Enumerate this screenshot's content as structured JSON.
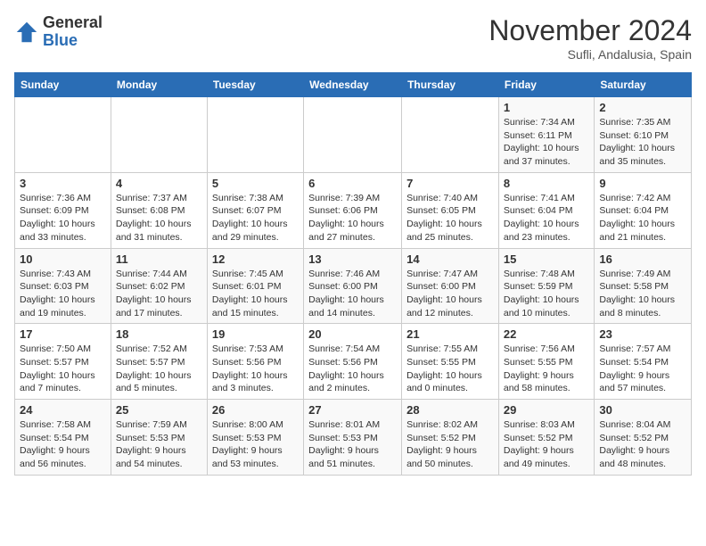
{
  "logo": {
    "line1": "General",
    "line2": "Blue"
  },
  "title": "November 2024",
  "location": "Sufli, Andalusia, Spain",
  "weekdays": [
    "Sunday",
    "Monday",
    "Tuesday",
    "Wednesday",
    "Thursday",
    "Friday",
    "Saturday"
  ],
  "weeks": [
    [
      {
        "day": "",
        "info": ""
      },
      {
        "day": "",
        "info": ""
      },
      {
        "day": "",
        "info": ""
      },
      {
        "day": "",
        "info": ""
      },
      {
        "day": "",
        "info": ""
      },
      {
        "day": "1",
        "info": "Sunrise: 7:34 AM\nSunset: 6:11 PM\nDaylight: 10 hours and 37 minutes."
      },
      {
        "day": "2",
        "info": "Sunrise: 7:35 AM\nSunset: 6:10 PM\nDaylight: 10 hours and 35 minutes."
      }
    ],
    [
      {
        "day": "3",
        "info": "Sunrise: 7:36 AM\nSunset: 6:09 PM\nDaylight: 10 hours and 33 minutes."
      },
      {
        "day": "4",
        "info": "Sunrise: 7:37 AM\nSunset: 6:08 PM\nDaylight: 10 hours and 31 minutes."
      },
      {
        "day": "5",
        "info": "Sunrise: 7:38 AM\nSunset: 6:07 PM\nDaylight: 10 hours and 29 minutes."
      },
      {
        "day": "6",
        "info": "Sunrise: 7:39 AM\nSunset: 6:06 PM\nDaylight: 10 hours and 27 minutes."
      },
      {
        "day": "7",
        "info": "Sunrise: 7:40 AM\nSunset: 6:05 PM\nDaylight: 10 hours and 25 minutes."
      },
      {
        "day": "8",
        "info": "Sunrise: 7:41 AM\nSunset: 6:04 PM\nDaylight: 10 hours and 23 minutes."
      },
      {
        "day": "9",
        "info": "Sunrise: 7:42 AM\nSunset: 6:04 PM\nDaylight: 10 hours and 21 minutes."
      }
    ],
    [
      {
        "day": "10",
        "info": "Sunrise: 7:43 AM\nSunset: 6:03 PM\nDaylight: 10 hours and 19 minutes."
      },
      {
        "day": "11",
        "info": "Sunrise: 7:44 AM\nSunset: 6:02 PM\nDaylight: 10 hours and 17 minutes."
      },
      {
        "day": "12",
        "info": "Sunrise: 7:45 AM\nSunset: 6:01 PM\nDaylight: 10 hours and 15 minutes."
      },
      {
        "day": "13",
        "info": "Sunrise: 7:46 AM\nSunset: 6:00 PM\nDaylight: 10 hours and 14 minutes."
      },
      {
        "day": "14",
        "info": "Sunrise: 7:47 AM\nSunset: 6:00 PM\nDaylight: 10 hours and 12 minutes."
      },
      {
        "day": "15",
        "info": "Sunrise: 7:48 AM\nSunset: 5:59 PM\nDaylight: 10 hours and 10 minutes."
      },
      {
        "day": "16",
        "info": "Sunrise: 7:49 AM\nSunset: 5:58 PM\nDaylight: 10 hours and 8 minutes."
      }
    ],
    [
      {
        "day": "17",
        "info": "Sunrise: 7:50 AM\nSunset: 5:57 PM\nDaylight: 10 hours and 7 minutes."
      },
      {
        "day": "18",
        "info": "Sunrise: 7:52 AM\nSunset: 5:57 PM\nDaylight: 10 hours and 5 minutes."
      },
      {
        "day": "19",
        "info": "Sunrise: 7:53 AM\nSunset: 5:56 PM\nDaylight: 10 hours and 3 minutes."
      },
      {
        "day": "20",
        "info": "Sunrise: 7:54 AM\nSunset: 5:56 PM\nDaylight: 10 hours and 2 minutes."
      },
      {
        "day": "21",
        "info": "Sunrise: 7:55 AM\nSunset: 5:55 PM\nDaylight: 10 hours and 0 minutes."
      },
      {
        "day": "22",
        "info": "Sunrise: 7:56 AM\nSunset: 5:55 PM\nDaylight: 9 hours and 58 minutes."
      },
      {
        "day": "23",
        "info": "Sunrise: 7:57 AM\nSunset: 5:54 PM\nDaylight: 9 hours and 57 minutes."
      }
    ],
    [
      {
        "day": "24",
        "info": "Sunrise: 7:58 AM\nSunset: 5:54 PM\nDaylight: 9 hours and 56 minutes."
      },
      {
        "day": "25",
        "info": "Sunrise: 7:59 AM\nSunset: 5:53 PM\nDaylight: 9 hours and 54 minutes."
      },
      {
        "day": "26",
        "info": "Sunrise: 8:00 AM\nSunset: 5:53 PM\nDaylight: 9 hours and 53 minutes."
      },
      {
        "day": "27",
        "info": "Sunrise: 8:01 AM\nSunset: 5:53 PM\nDaylight: 9 hours and 51 minutes."
      },
      {
        "day": "28",
        "info": "Sunrise: 8:02 AM\nSunset: 5:52 PM\nDaylight: 9 hours and 50 minutes."
      },
      {
        "day": "29",
        "info": "Sunrise: 8:03 AM\nSunset: 5:52 PM\nDaylight: 9 hours and 49 minutes."
      },
      {
        "day": "30",
        "info": "Sunrise: 8:04 AM\nSunset: 5:52 PM\nDaylight: 9 hours and 48 minutes."
      }
    ]
  ]
}
